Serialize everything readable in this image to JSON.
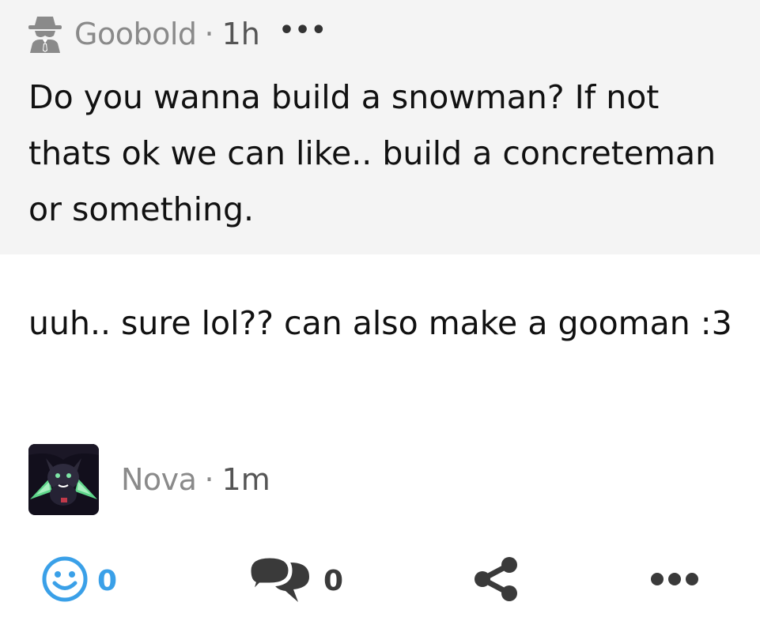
{
  "quoted_post": {
    "author": "Goobold",
    "separator": "·",
    "time": "1h",
    "more": "•••",
    "text": "Do you wanna build a snowman? If not thats ok we can like.. build a concreteman or something."
  },
  "reply": {
    "text": "uuh.. sure lol?? can also make a gooman :3",
    "author": "Nova",
    "separator": "·",
    "time": "1m"
  },
  "actions": {
    "reaction_count": "0",
    "comment_count": "0",
    "more": "•••"
  },
  "colors": {
    "quoted_background": "#f4f4f4",
    "meta_gray": "#8a8a8a",
    "reaction_blue": "#3aa0e8",
    "icon_dark": "#3a3a3a"
  },
  "icons": {
    "anonymous": "spy-icon",
    "reaction": "smiley-icon",
    "comment": "comments-icon",
    "share": "share-icon",
    "more": "more-dots-icon"
  }
}
